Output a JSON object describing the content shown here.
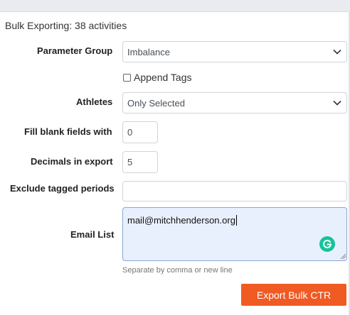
{
  "summary": "Bulk Exporting: 38 activities",
  "form": {
    "parameter_group": {
      "label": "Parameter Group",
      "value": "Imbalance"
    },
    "append_tags": {
      "label": "Append Tags",
      "checked": false
    },
    "athletes": {
      "label": "Athletes",
      "value": "Only Selected"
    },
    "fill_blank": {
      "label": "Fill blank fields with",
      "value": "0"
    },
    "decimals": {
      "label": "Decimals in export",
      "value": "5"
    },
    "exclude_tagged": {
      "label": "Exclude tagged periods",
      "value": ""
    },
    "email_list": {
      "label": "Email List",
      "value": "mail@mitchhenderson.org",
      "hint": "Separate by comma or new line"
    }
  },
  "export_button": {
    "label": "Export Bulk CTR",
    "color": "#f05a23"
  },
  "icons": {
    "select_arrow": "chevron-down-icon",
    "grammarly": "grammarly-icon"
  }
}
